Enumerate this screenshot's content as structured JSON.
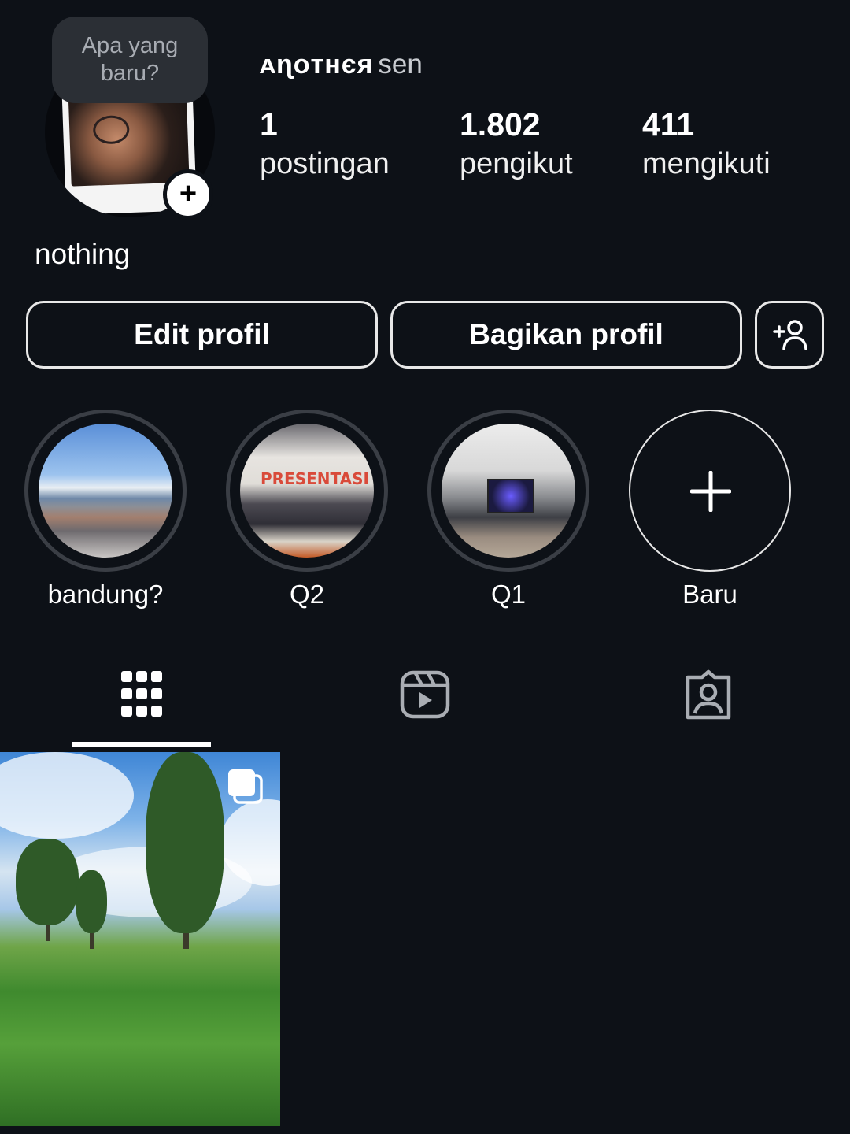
{
  "profile": {
    "note": "Apa yang baru?",
    "name_main": "ᴀɳᴏᴛʜєя",
    "name_sub": "sen",
    "bio": "nothing"
  },
  "stats": {
    "posts": {
      "value": "1",
      "label": "postingan"
    },
    "followers": {
      "value": "1.802",
      "label": "pengikut"
    },
    "following": {
      "value": "411",
      "label": "mengikuti"
    }
  },
  "buttons": {
    "edit": "Edit profil",
    "share": "Bagikan profil",
    "add_user_icon": "add-person-icon"
  },
  "highlights": [
    {
      "label": "bandung?"
    },
    {
      "label": "Q2",
      "image_text": "PRESENTASI"
    },
    {
      "label": "Q1"
    },
    {
      "label": "Baru"
    }
  ],
  "tabs": [
    {
      "icon": "grid-icon",
      "active": true
    },
    {
      "icon": "reels-icon",
      "active": false
    },
    {
      "icon": "tagged-icon",
      "active": false
    }
  ],
  "colors": {
    "background": "#0d1117",
    "text": "#ffffff",
    "note_bubble": "#2b2f35"
  }
}
